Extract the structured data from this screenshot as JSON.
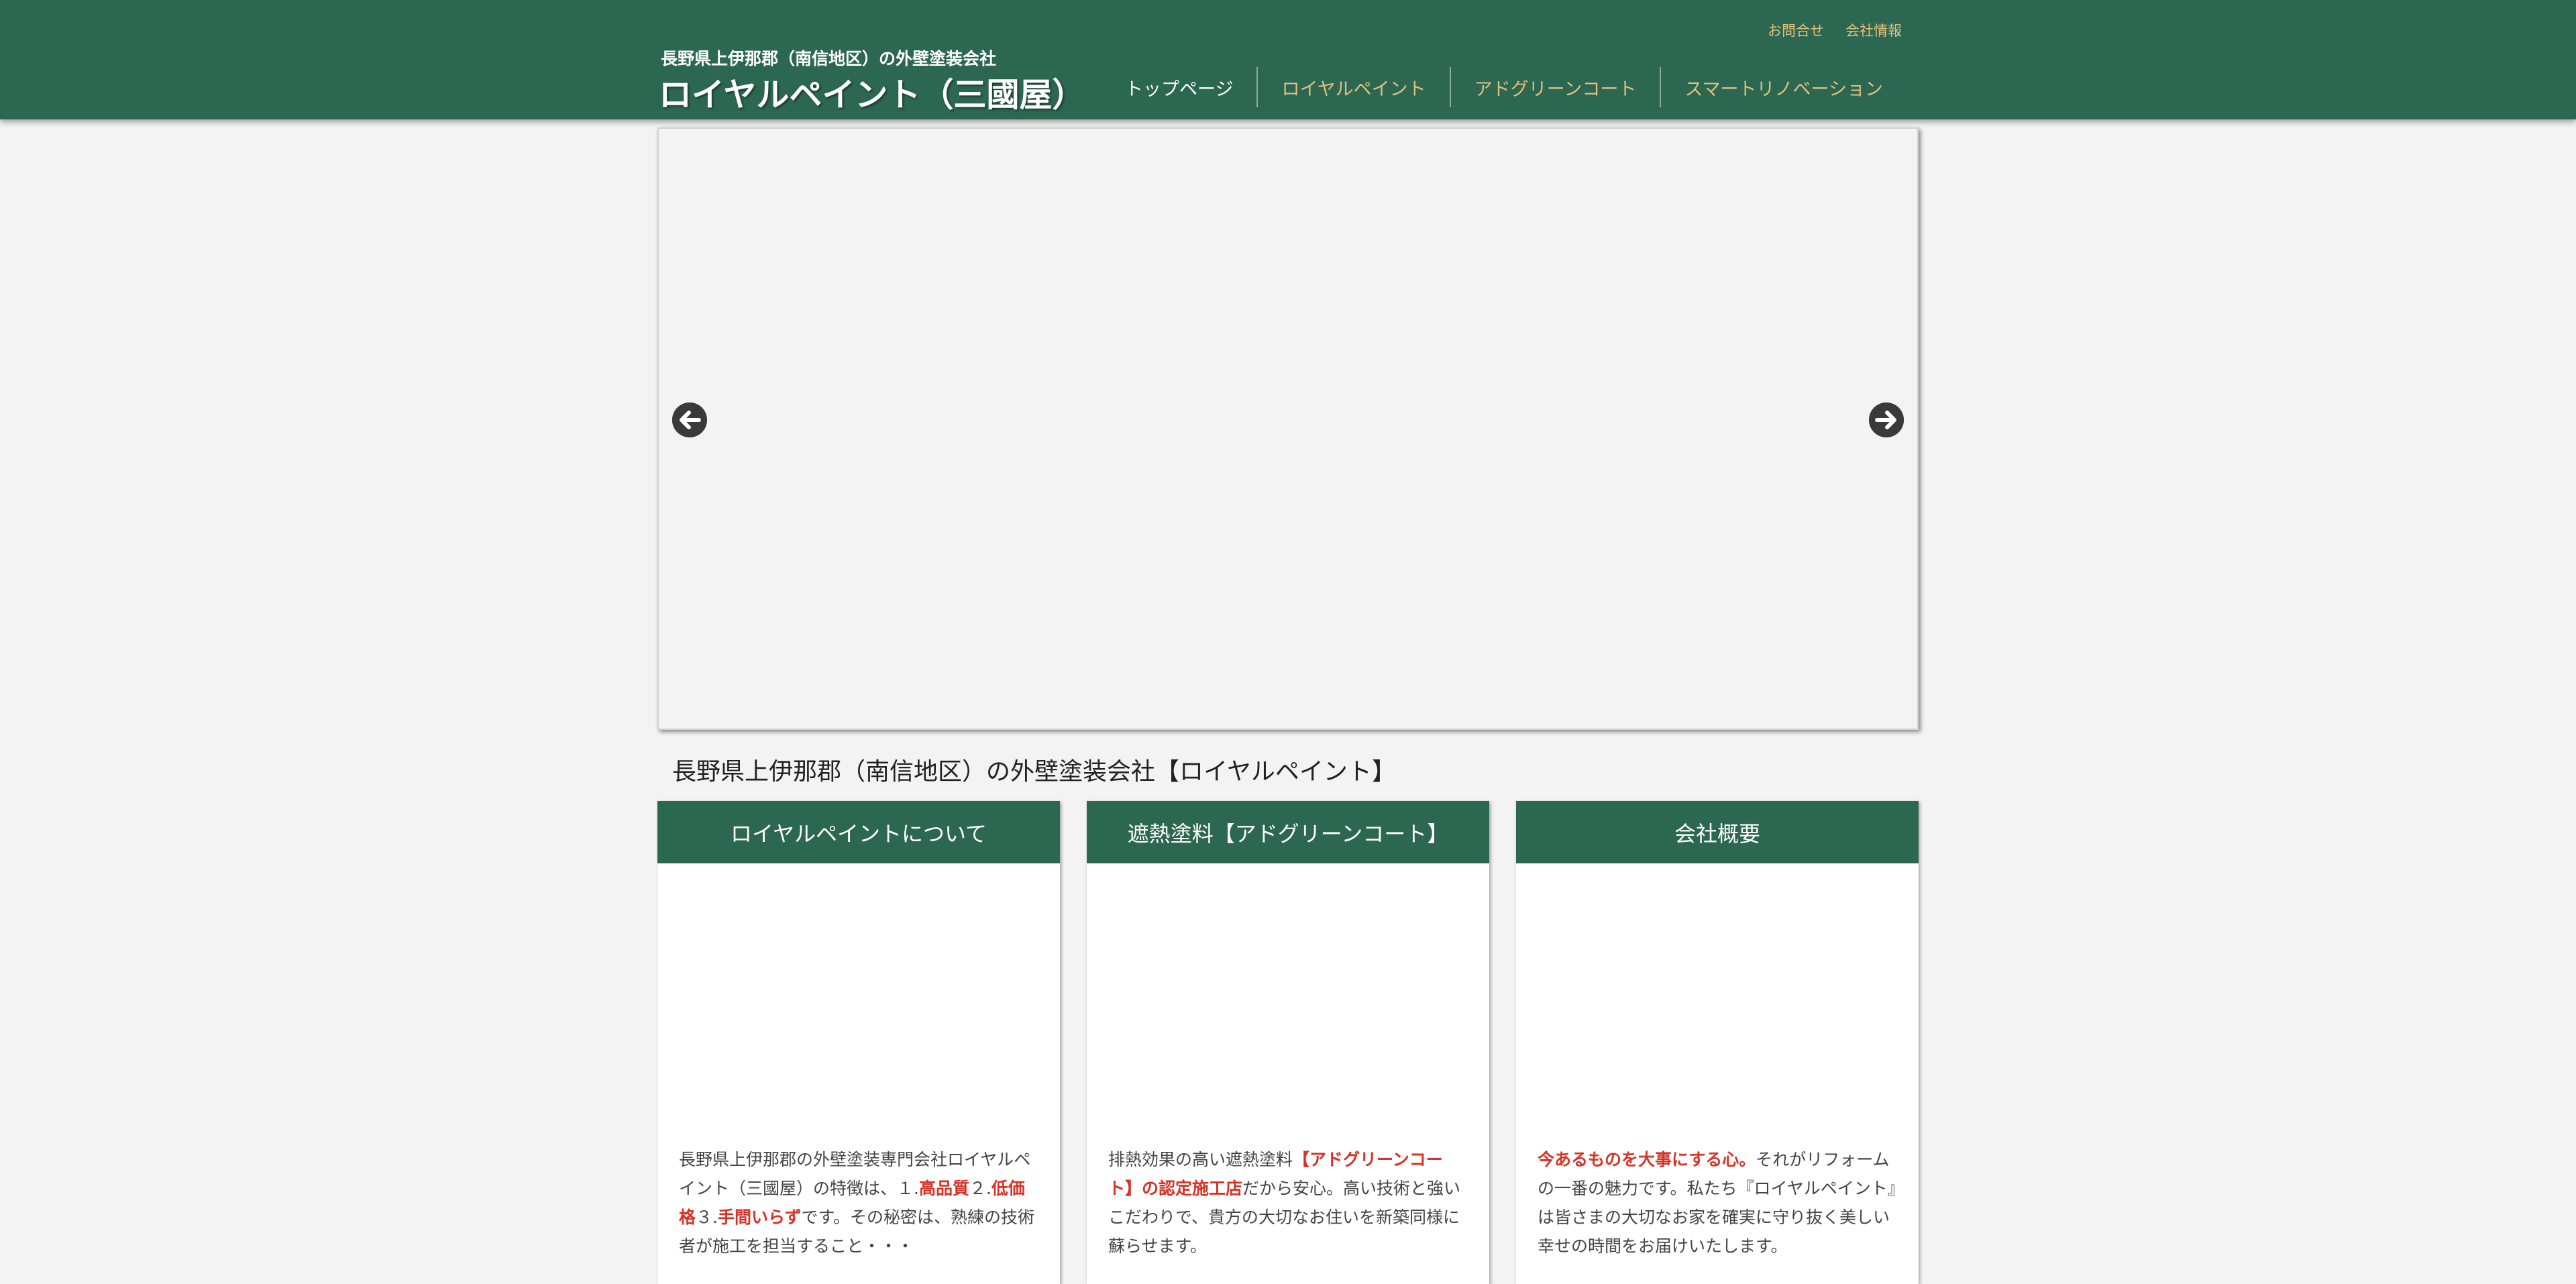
{
  "header": {
    "tagline": "長野県上伊那郡（南信地区）の外壁塗装会社",
    "logo": "ロイヤルペイント（三國屋）",
    "util_links": [
      "お問合せ",
      "会社情報"
    ],
    "nav": [
      "トップページ",
      "ロイヤルペイント",
      "アドグリーンコート",
      "スマートリノベーション"
    ]
  },
  "slider": {
    "prev_icon": "arrow-left-circle-icon",
    "next_icon": "arrow-right-circle-icon"
  },
  "section_title": "長野県上伊那郡（南信地区）の外壁塗装会社【ロイヤルペイント】",
  "cards": [
    {
      "title": "ロイヤルペイントについて",
      "text": [
        {
          "t": "長野県上伊那郡の外壁塗装専門会社ロイヤルペイント（三國屋）の特徴は、１.",
          "hl": false
        },
        {
          "t": "高品質",
          "hl": true
        },
        {
          "t": "２.",
          "hl": false
        },
        {
          "t": "低価格",
          "hl": true
        },
        {
          "t": "３.",
          "hl": false
        },
        {
          "t": "手間いらず",
          "hl": true
        },
        {
          "t": "です。その秘密は、熟練の技術者が施工を担当すること・・・",
          "hl": false
        }
      ]
    },
    {
      "title": "遮熱塗料【アドグリーンコート】",
      "text": [
        {
          "t": "排熱効果の高い遮熱塗料",
          "hl": false
        },
        {
          "t": "【アドグリーンコート】の認定施工店",
          "hl": true
        },
        {
          "t": "だから安心。高い技術と強いこだわりで、貴方の大切なお住いを新築同様に蘇らせます。",
          "hl": false
        }
      ]
    },
    {
      "title": "会社概要",
      "text": [
        {
          "t": "今あるものを大事にする心。",
          "hl": true
        },
        {
          "t": "それがリフォームの一番の魅力です。私たち『ロイヤルペイント』は皆さまの大切なお家を確実に守り抜く美しい幸せの時間をお届けいたします。",
          "hl": false
        }
      ]
    }
  ],
  "colors": {
    "brand_green": "#2c6752",
    "nav_gold": "#e5c07a",
    "highlight_red": "#d63326",
    "page_bg": "#f3f3f3"
  }
}
